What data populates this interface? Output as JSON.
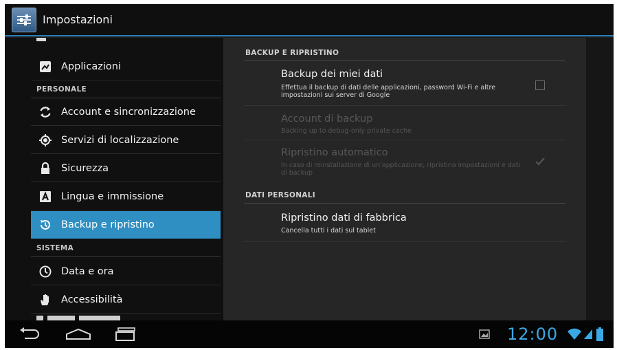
{
  "actionbar": {
    "icon": "settings-sliders-icon",
    "title": "Impostazioni"
  },
  "sidebar": {
    "items": [
      {
        "label": "Applicazioni",
        "icon": "apps-icon"
      },
      {
        "label": "Account e sincronizzazione",
        "icon": "sync-icon"
      },
      {
        "label": "Servizi di localizzazione",
        "icon": "location-icon"
      },
      {
        "label": "Sicurezza",
        "icon": "lock-icon"
      },
      {
        "label": "Lingua e immissione",
        "icon": "keyboard-a-icon"
      },
      {
        "label": "Backup e ripristino",
        "icon": "backup-restore-icon",
        "active": true
      },
      {
        "label": "Data e ora",
        "icon": "clock-icon"
      },
      {
        "label": "Accessibilità",
        "icon": "hand-icon"
      }
    ],
    "headers": {
      "personal": "PERSONALE",
      "system": "SISTEMA"
    }
  },
  "detail": {
    "backup_section": "BACKUP E RIPRISTINO",
    "backup_data": {
      "title": "Backup dei miei dati",
      "summary": "Effettua il backup di dati delle applicazioni, password Wi-Fi e altre impostazioni sui server di Google",
      "checked": false
    },
    "backup_account": {
      "title": "Account di backup",
      "summary": "Backing up to debug-only private cache",
      "enabled": false
    },
    "auto_restore": {
      "title": "Ripristino automatico",
      "summary": "In caso di reinstallazione di un'applicazione, ripristina impostazioni e dati di backup",
      "checked": true,
      "enabled": false
    },
    "personal_section": "DATI PERSONALI",
    "factory_reset": {
      "title": "Ripristino dati di fabbrica",
      "summary": "Cancella tutti i dati sul tablet"
    }
  },
  "systembar": {
    "clock": "12:00",
    "accent": "#3aa8e4",
    "active_item_color": "#2f8fc2"
  }
}
